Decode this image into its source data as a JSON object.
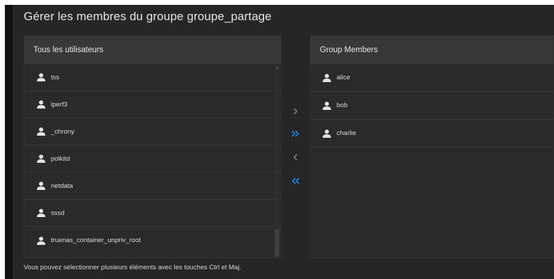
{
  "title": "Gérer les membres du groupe groupe_partage",
  "all_users": {
    "header": "Tous les utilisateurs",
    "items": [
      "tss",
      "iperf3",
      "_chrony",
      "polkitd",
      "netdata",
      "sssd",
      "truenas_container_unpriv_root"
    ]
  },
  "group_members": {
    "header": "Group Members",
    "items": [
      "alice",
      "bob",
      "charlie"
    ]
  },
  "transfer_buttons": {
    "add_selected_icon": "chevron-right-icon",
    "add_all_icon": "double-chevron-right-icon",
    "remove_selected_icon": "chevron-left-icon",
    "remove_all_icon": "double-chevron-left-icon"
  },
  "hint": "Vous pouvez sélectionner plusieurs éléments avec les touches Ctrl et Maj.",
  "colors": {
    "background": "#262626",
    "panel_header": "#383838",
    "accent_blue": "#1e88e5",
    "text": "#e0e0e0"
  }
}
